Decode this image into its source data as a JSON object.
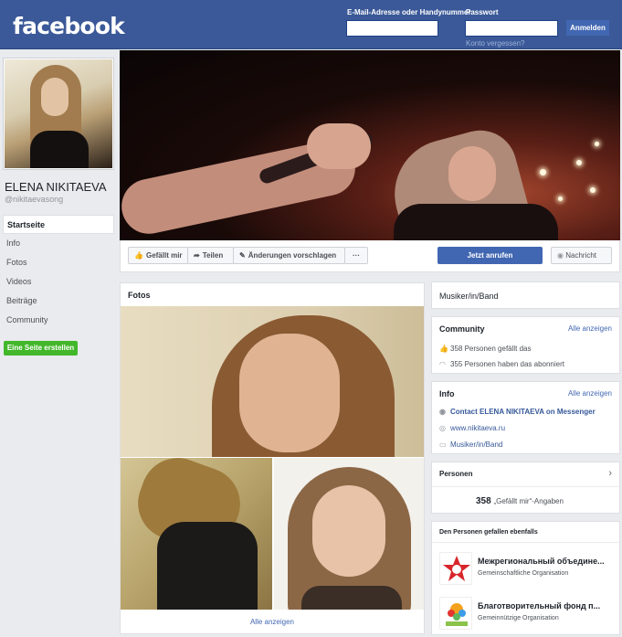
{
  "header": {
    "logo": "facebook",
    "email_label": "E-Mail-Adresse oder Handynummer",
    "email_value": "",
    "password_label": "Passwort",
    "password_value": "",
    "login_button": "Anmelden",
    "forgot_link": "Konto vergessen?"
  },
  "profile": {
    "name": "ELENA NIKITAEVA",
    "handle": "@nikitaevasong"
  },
  "nav": {
    "items": [
      "Startseite",
      "Info",
      "Fotos",
      "Videos",
      "Beiträge",
      "Community"
    ],
    "active": "Startseite",
    "create_page": "Eine Seite erstellen"
  },
  "actions": {
    "like": "Gefällt mir",
    "share": "Teilen",
    "suggest": "Änderungen vorschlagen",
    "more": "···",
    "call": "Jetzt anrufen",
    "message": "Nachricht"
  },
  "photos": {
    "title": "Fotos",
    "see_all": "Alle anzeigen"
  },
  "category_card": {
    "text": "Musiker/in/Band"
  },
  "community": {
    "title": "Community",
    "see_all": "Alle anzeigen",
    "likes": "358 Personen gefällt das",
    "follows": "355 Personen haben das abonniert"
  },
  "info": {
    "title": "Info",
    "see_all": "Alle anzeigen",
    "messenger": "Contact ELENA NIKITAEVA on Messenger",
    "website": "www.nikitaeva.ru",
    "category": "Musiker/in/Band"
  },
  "people": {
    "title": "Personen",
    "count": "358",
    "count_suffix": "„Gefällt mir“-Angaben"
  },
  "also_liked": {
    "title": "Den Personen gefallen ebenfalls",
    "items": [
      {
        "name": "Межрегиональный объедине...",
        "category": "Gemeinschaftliche Organisation"
      },
      {
        "name": "Благотворительный фонд п...",
        "category": "Gemeinnützige Organisation"
      }
    ]
  },
  "colors": {
    "brand_blue": "#3b5998",
    "button_blue": "#4267b2",
    "green": "#42b72a",
    "page_bg": "#e9ebee"
  }
}
